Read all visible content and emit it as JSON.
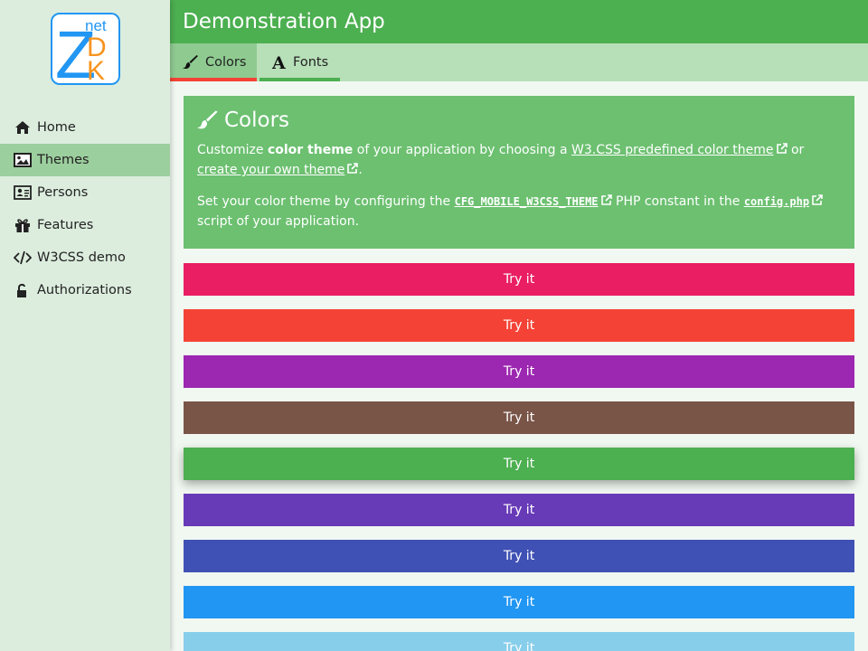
{
  "app_title": "Demonstration App",
  "logo": {
    "letters": [
      "Z",
      "net",
      "D",
      "K"
    ]
  },
  "sidebar": {
    "items": [
      {
        "label": "Home",
        "icon": "home-icon"
      },
      {
        "label": "Themes",
        "icon": "image-icon",
        "active": true
      },
      {
        "label": "Persons",
        "icon": "id-card-icon"
      },
      {
        "label": "Features",
        "icon": "gift-icon"
      },
      {
        "label": "W3CSS demo",
        "icon": "code-icon"
      },
      {
        "label": "Authorizations",
        "icon": "unlock-icon"
      }
    ]
  },
  "tabs": [
    {
      "label": "Colors",
      "icon": "paint-brush-icon",
      "active": true
    },
    {
      "label": "Fonts",
      "icon": "font-icon"
    }
  ],
  "panel": {
    "title": "Colors",
    "p1": {
      "t1": "Customize ",
      "bold": "color theme",
      "t2": " of your application by choosing a ",
      "link1": "W3.CSS predefined color theme",
      "t3": " or ",
      "link2": "create your own theme",
      "t4": "."
    },
    "p2": {
      "t1": "Set your color theme by configuring the ",
      "code1": "CFG_MOBILE_W3CSS_THEME",
      "t2": " PHP constant in the ",
      "code2": "config.php",
      "t3": " script of your application."
    }
  },
  "buttons": [
    {
      "label": "Try it",
      "color": "#e91e63"
    },
    {
      "label": "Try it",
      "color": "#f44336"
    },
    {
      "label": "Try it",
      "color": "#9c27b0"
    },
    {
      "label": "Try it",
      "color": "#795548"
    },
    {
      "label": "Try it",
      "color": "#4caf50",
      "raised": true
    },
    {
      "label": "Try it",
      "color": "#673ab7"
    },
    {
      "label": "Try it",
      "color": "#3f51b5"
    },
    {
      "label": "Try it",
      "color": "#2196f3"
    },
    {
      "label": "Try it",
      "color": "#87ceeb"
    }
  ]
}
